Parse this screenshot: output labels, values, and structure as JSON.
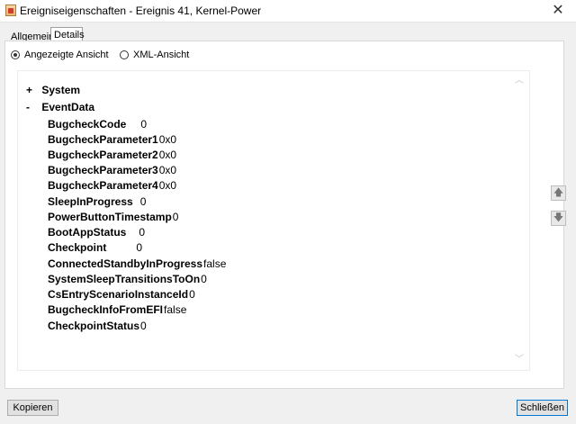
{
  "window": {
    "title": "Ereigniseigenschaften - Ereignis 41, Kernel-Power"
  },
  "tabs": [
    {
      "label": "Allgemein",
      "active": false
    },
    {
      "label": "Details",
      "active": true
    }
  ],
  "view_options": [
    {
      "label": "Angezeigte Ansicht",
      "selected": true
    },
    {
      "label": "XML-Ansicht",
      "selected": false
    }
  ],
  "tree": {
    "system": {
      "sign": "+",
      "label": "System"
    },
    "eventdata": {
      "sign": "-",
      "label": "EventData"
    },
    "rows": [
      {
        "key": "BugcheckCode",
        "value": "0"
      },
      {
        "key": "BugcheckParameter1",
        "value": "0x0"
      },
      {
        "key": "BugcheckParameter2",
        "value": "0x0"
      },
      {
        "key": "BugcheckParameter3",
        "value": "0x0"
      },
      {
        "key": "BugcheckParameter4",
        "value": "0x0"
      },
      {
        "key": "SleepInProgress",
        "value": "0"
      },
      {
        "key": "PowerButtonTimestamp",
        "value": "0"
      },
      {
        "key": "BootAppStatus",
        "value": "0"
      },
      {
        "key": "Checkpoint",
        "value": "0"
      },
      {
        "key": "ConnectedStandbyInProgress",
        "value": "false"
      },
      {
        "key": "SystemSleepTransitionsToOn",
        "value": "0"
      },
      {
        "key": "CsEntryScenarioInstanceId",
        "value": "0"
      },
      {
        "key": "BugcheckInfoFromEFI",
        "value": "false"
      },
      {
        "key": "CheckpointStatus",
        "value": "0"
      }
    ]
  },
  "buttons": {
    "copy": "Kopieren",
    "close": "Schließen"
  },
  "icons": {
    "close": "close-icon",
    "up": "arrow-up-icon",
    "down": "arrow-down-icon"
  }
}
